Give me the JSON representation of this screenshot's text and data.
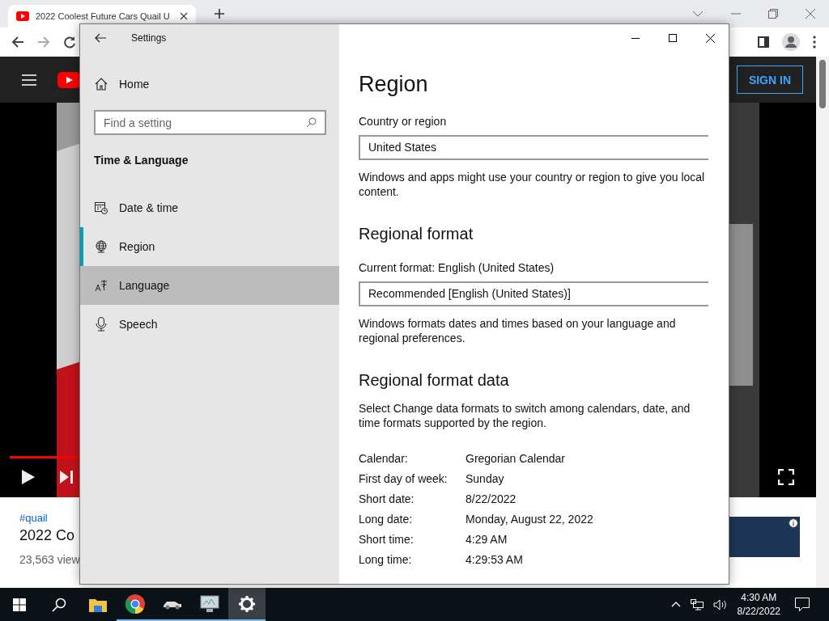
{
  "browser": {
    "tab_title": "2022 Coolest Future Cars Quail U",
    "sign_in": "SIGN IN",
    "hashtag": "#quail",
    "video_title": "2022 Co",
    "views": "23,563 view"
  },
  "settings": {
    "title": "Settings",
    "home": "Home",
    "search": {
      "placeholder": "Find a setting"
    },
    "section": "Time & Language",
    "items": [
      {
        "label": "Date & time",
        "kind": "date",
        "selected": false,
        "hovered": false
      },
      {
        "label": "Region",
        "kind": "region",
        "selected": true,
        "hovered": false
      },
      {
        "label": "Language",
        "kind": "language",
        "selected": false,
        "hovered": true
      },
      {
        "label": "Speech",
        "kind": "speech",
        "selected": false,
        "hovered": false
      }
    ],
    "page_title": "Region",
    "country": {
      "label": "Country or region",
      "value": "United States",
      "description": "Windows and apps might use your country or region to give you local content."
    },
    "format": {
      "heading": "Regional format",
      "label": "Current format: English (United States)",
      "value": "Recommended [English (United States)]",
      "description": "Windows formats dates and times based on your language and regional preferences."
    },
    "format_data": {
      "heading": "Regional format data",
      "description": "Select Change data formats to switch among calendars, date, and time formats supported by the region.",
      "rows": [
        {
          "label": "Calendar:",
          "value": "Gregorian Calendar"
        },
        {
          "label": "First day of week:",
          "value": "Sunday"
        },
        {
          "label": "Short date:",
          "value": "8/22/2022"
        },
        {
          "label": "Long date:",
          "value": "Monday, August 22, 2022"
        },
        {
          "label": "Short time:",
          "value": "4:29 AM"
        },
        {
          "label": "Long time:",
          "value": "4:29:53 AM"
        }
      ]
    }
  },
  "taskbar": {
    "apps": [
      {
        "kind": "explorer",
        "running": false,
        "selected": false
      },
      {
        "kind": "chrome",
        "running": true,
        "selected": false
      },
      {
        "kind": "car",
        "running": true,
        "selected": false
      },
      {
        "kind": "monitor",
        "running": true,
        "selected": false
      },
      {
        "kind": "settings",
        "running": true,
        "selected": true
      }
    ],
    "time": "4:30 AM",
    "date": "8/22/2022"
  }
}
